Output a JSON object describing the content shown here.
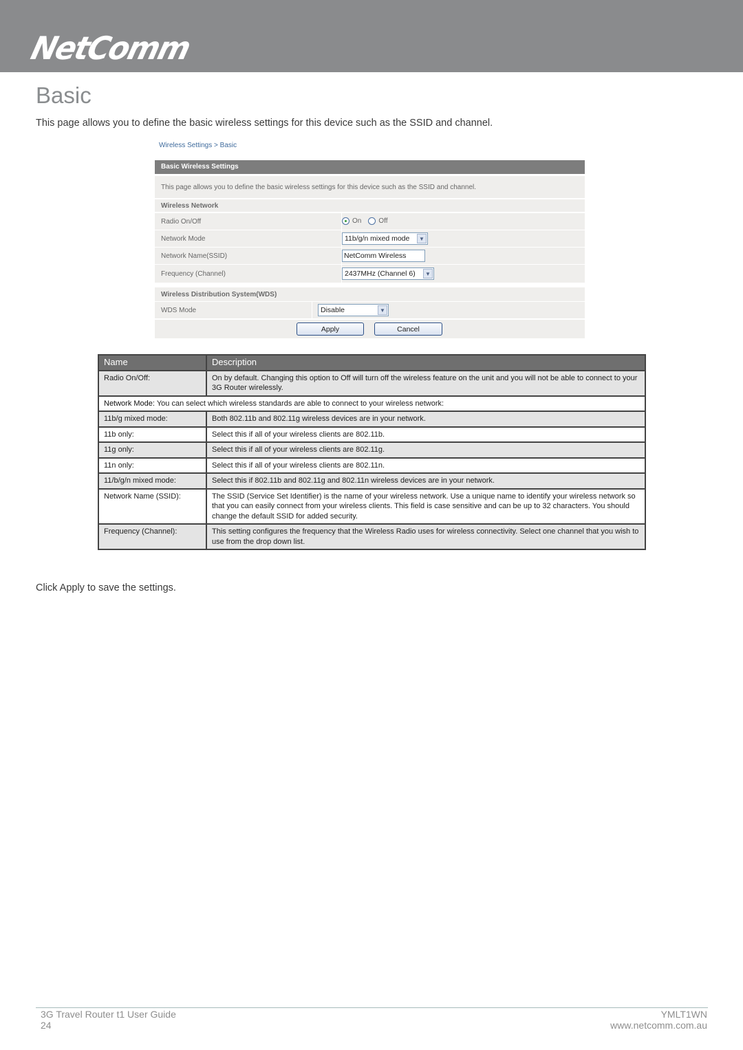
{
  "header": {
    "logo": "NetComm"
  },
  "page": {
    "title": "Basic",
    "intro": "This page allows you to define the basic wireless settings for this device such as the SSID and channel.",
    "outro": "Click Apply to save the settings."
  },
  "screenshot": {
    "breadcrumb": "Wireless Settings > Basic",
    "header": "Basic Wireless Settings",
    "description": "This page allows you to define the basic wireless settings for this device such as the SSID and channel.",
    "wireless_network": {
      "title": "Wireless Network",
      "radio_label": "Radio On/Off",
      "radio_on": "On",
      "radio_off": "Off",
      "radio_selected": "On",
      "mode_label": "Network Mode",
      "mode_value": "11b/g/n mixed mode",
      "ssid_label": "Network Name(SSID)",
      "ssid_value": "NetComm Wireless",
      "freq_label": "Frequency (Channel)",
      "freq_value": "2437MHz (Channel 6)"
    },
    "wds": {
      "title": "Wireless Distribution System(WDS)",
      "mode_label": "WDS Mode",
      "mode_value": "Disable"
    },
    "apply": "Apply",
    "cancel": "Cancel"
  },
  "table": {
    "headers": [
      "Name",
      "Description"
    ],
    "rows": [
      {
        "name": "Radio On/Off:",
        "desc": "On by default. Changing this option to Off will turn off the wireless feature on the unit and you will not be able to connect to your 3G Router wirelessly."
      },
      {
        "name_bold": "Network Mode:",
        "desc": " You can select which wireless standards are able to connect to your wireless network:"
      },
      {
        "name": "11b/g mixed mode:",
        "desc": "Both 802.11b and 802.11g wireless devices are in your network."
      },
      {
        "name": "11b only:",
        "desc": "Select this if all of your wireless clients are 802.11b."
      },
      {
        "name": "11g only:",
        "desc": "Select this if all of your wireless clients are 802.11g."
      },
      {
        "name": "11n only:",
        "desc": "Select this if all of your wireless clients are 802.11n."
      },
      {
        "name": "11/b/g/n  mixed mode:",
        "desc": "Select this if 802.11b and 802.11g and 802.11n wireless devices are in your network."
      },
      {
        "name": "Network Name (SSID):",
        "desc": "The SSID (Service Set Identifier) is the name of your wireless network. Use a unique name to identify your wireless network so that you can easily connect from your wireless clients. This field is case sensitive and can be up to 32 characters. You should change the default SSID for added security."
      },
      {
        "name": "Frequency (Channel):",
        "desc": "This setting configures the frequency that the Wireless Radio uses for wireless connectivity. Select one channel that you wish to use from the drop down list."
      }
    ]
  },
  "footer": {
    "guide": "3G Travel Router t1 User Guide",
    "page_number": "24",
    "model": "YMLT1WN",
    "website": "www.netcomm.com.au"
  }
}
